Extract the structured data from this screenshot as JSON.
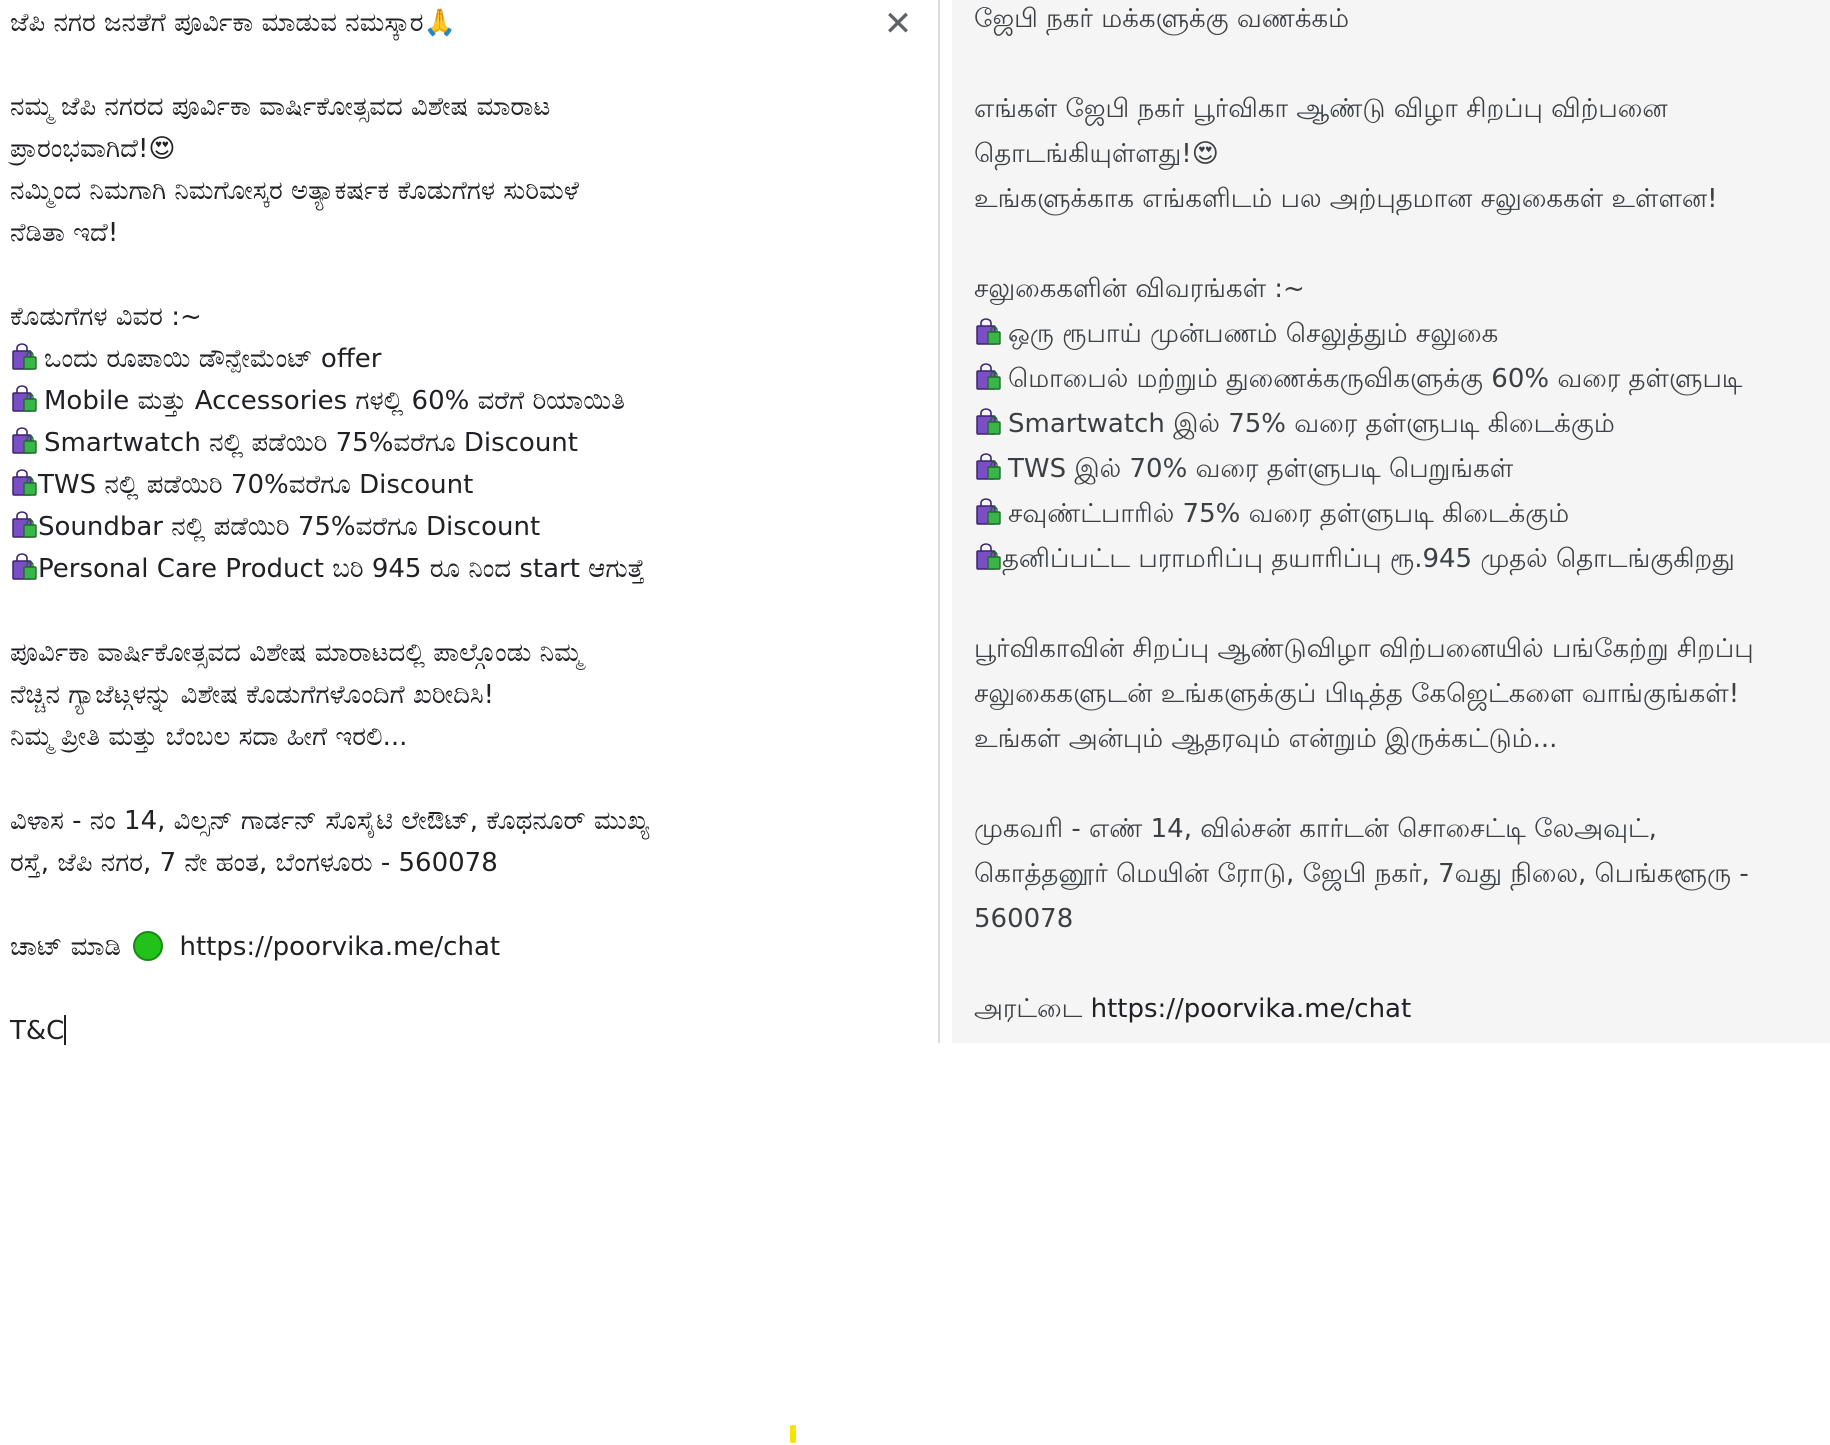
{
  "source": {
    "close_icon": "close-icon",
    "lines": {
      "l1": "ಜೆಪಿ ನಗರ ಜನತೆಗೆ ಪೂರ್ವಿಕಾ ಮಾಡುವ ನಮಸ್ಕಾರ🙏",
      "l2": "ನಮ್ಮ ಜೆಪಿ ನಗರದ  ಪೂರ್ವಿಕಾ ವಾರ್ಷಿಕೋತ್ಸವದ ವಿಶೇಷ ಮಾರಾಟ",
      "l3": "ಪ್ರಾರಂಭವಾಗಿದೆ!😍",
      "l4": "ನಮ್ಮಿಂದ ನಿಮಗಾಗಿ ನಿಮಗೋಸ್ಕರ ಅತ್ಯಾಕರ್ಷಕ ಕೊಡುಗೆಗಳ ಸುರಿಮಳೆ",
      "l5": "ನೆಡಿತಾ ಇದೆ!",
      "l6": "ಕೊಡುಗೆಗಳ ವಿವರ :~",
      "o1": "ಒಂದು ರೂಪಾಯಿ ಡೌನ್ಪೇಮೆಂಟ್ offer",
      "o2": "Mobile ಮತ್ತು Accessories ಗಳಲ್ಲಿ 60% ವರೆಗೆ ರಿಯಾಯಿತಿ",
      "o3": "Smartwatch ನಲ್ಲಿ ಪಡೆಯಿರಿ 75%ವರೆಗೂ Discount",
      "o4": "TWS ನಲ್ಲಿ ಪಡೆಯಿರಿ 70%ವರೆಗೂ Discount",
      "o5": "Soundbar ನಲ್ಲಿ ಪಡೆಯಿರಿ 75%ವರೆಗೂ Discount",
      "o6": "Personal Care Product ಬರಿ 945 ರೂ ನಿಂದ start ಆಗುತ್ತೆ",
      "p1": "ಪೂರ್ವಿಕಾ ವಾರ್ಷಿಕೋತ್ಸವದ ವಿಶೇಷ ಮಾರಾಟದಲ್ಲಿ ಪಾಲ್ಗೊಂಡು ನಿಮ್ಮ",
      "p2": "ನೆಚ್ಚಿನ ಗ್ಯಾಜೆಟ್ಗಳನ್ನು ವಿಶೇಷ ಕೊಡುಗೆಗಳೊಂದಿಗೆ ಖರೀದಿಸಿ!",
      "p3": "ನಿಮ್ಮ ಪ್ರೀತಿ ಮತ್ತು ಬೆಂಬಲ ಸದಾ ಹೀಗೆ ಇರಲಿ...",
      "a1": "ವಿಳಾಸ - ನಂ 14, ವಿಲ್ಸನ್ ಗಾರ್ಡನ್ ಸೊಸೈಟಿ ಲೇಔಟ್, ಕೊಥನೂರ್ ಮುಖ್ಯ",
      "a2": "ರಸ್ತೆ, ಜೆಪಿ ನಗರ, 7 ನೇ ಹಂತ, ಬೆಂಗಳೂರು - 560078",
      "chat_label": "ಚಾಟ್ ಮಾಡಿ",
      "chat_link": "https://poorvika.me/chat",
      "tc": "T&C"
    }
  },
  "target": {
    "lines": {
      "l1": "ஜேபி நகர் மக்களுக்கு வணக்கம்",
      "l2": "எங்கள் ஜேபி நகர் பூர்விகா ஆண்டு விழா சிறப்பு விற்பனை",
      "l3": "தொடங்கியுள்ளது!😍",
      "l4": "உங்களுக்காக எங்களிடம் பல அற்புதமான சலுகைகள் உள்ளன!",
      "l5": "சலுகைகளின் விவரங்கள் :~",
      "o1": "ஒரு ரூபாய் முன்பணம் செலுத்தும் சலுகை",
      "o2": "மொபைல் மற்றும் துணைக்கருவிகளுக்கு 60% வரை தள்ளுபடி",
      "o3": "Smartwatch இல் 75% வரை தள்ளுபடி கிடைக்கும்",
      "o4": "TWS இல் 70% வரை தள்ளுபடி பெறுங்கள்",
      "o5": "சவுண்ட்பாரில் 75% வரை தள்ளுபடி கிடைக்கும்",
      "o6": "தனிப்பட்ட பராமரிப்பு தயாரிப்பு ரூ.945 முதல் தொடங்குகிறது",
      "p1": "பூர்விகாவின் சிறப்பு ஆண்டுவிழா விற்பனையில் பங்கேற்று சிறப்பு",
      "p2": "சலுகைகளுடன் உங்களுக்குப் பிடித்த கேஜெட்களை வாங்குங்கள்!",
      "p3": "உங்கள் அன்பும் ஆதரவும் என்றும் இருக்கட்டும்...",
      "a1": "முகவரி - எண் 14, வில்சன் கார்டன் சொசைட்டி லேஅவுட்,",
      "a2": "கொத்தனூர் மெயின் ரோடு, ஜேபி நகர், 7வது நிலை, பெங்களூரு -",
      "a3": "560078",
      "chat_label": "அரட்டை",
      "chat_link": "https://poorvika.me/chat"
    }
  },
  "icons": {
    "bag": "shopping-bag-icon",
    "green_dot": "green-circle-icon"
  },
  "colors": {
    "source_bg": "#ffffff",
    "target_bg": "#f5f5f5",
    "text": "#202124",
    "green": "#22c21a"
  }
}
